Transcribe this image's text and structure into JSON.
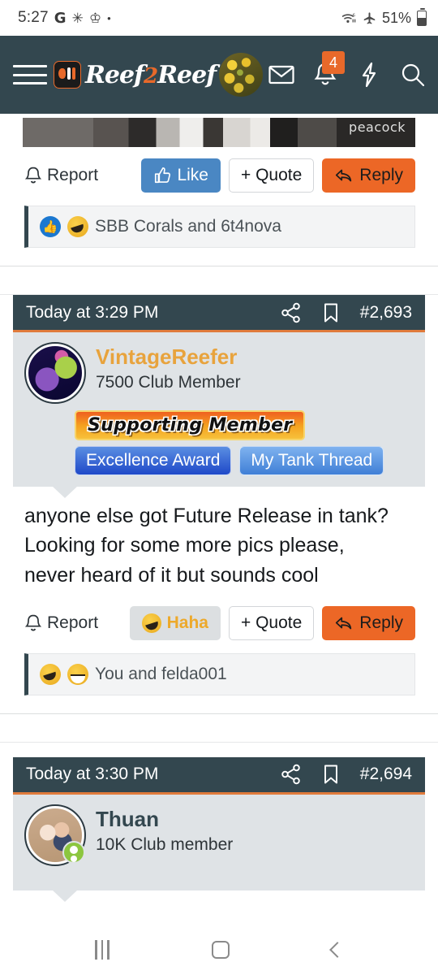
{
  "status_bar": {
    "time": "5:27",
    "google_glyph": "G",
    "asterisk_glyph": "✳",
    "trophy_glyph": "♔",
    "dot_glyph": "•",
    "battery_percent": "51%",
    "wifi_icon": "wifi-6-icon",
    "airplane_icon": "airplane-mode-icon",
    "battery_icon": "battery-icon"
  },
  "header": {
    "menu_icon": "hamburger-menu-icon",
    "logo_mark": "reef2reef-fish-logo",
    "brand_part1": "Reef",
    "brand_two": "2",
    "brand_part2": "Reef",
    "user_avatar": "coral-avatar",
    "inbox_icon": "envelope-icon",
    "alerts_icon": "bell-icon",
    "alerts_count": "4",
    "whats_new_icon": "lightning-bolt-icon",
    "search_icon": "search-icon",
    "bg_color": "#33474f",
    "accent_color": "#e8692a"
  },
  "post_top": {
    "media_watermark": "peacock",
    "report_label": "Report",
    "like_label": "Like",
    "quote_label": "+ Quote",
    "reply_label": "Reply",
    "reactions_text": "SBB Corals and 6t4nova"
  },
  "post_middle": {
    "timestamp": "Today at 3:29 PM",
    "post_number": "#2,693",
    "share_icon": "share-icon",
    "bookmark_icon": "bookmark-icon",
    "username": "VintageReefer",
    "user_title": "7500 Club Member",
    "avatar": "coral-reef-avatar",
    "badge_supporting": "Supporting Member",
    "badge_excellence": "Excellence Award",
    "badge_tank_thread": "My Tank Thread",
    "body_line1": "anyone else got Future Release in tank?",
    "body_line2": "Looking for some more pics please,",
    "body_line3": "never heard of it but sounds cool",
    "report_label": "Report",
    "haha_label": "Haha",
    "quote_label": "+ Quote",
    "reply_label": "Reply",
    "reactions_text": "You and felda001"
  },
  "post_bottom": {
    "timestamp": "Today at 3:30 PM",
    "post_number": "#2,694",
    "share_icon": "share-icon",
    "bookmark_icon": "bookmark-icon",
    "username": "Thuan",
    "user_title": "10K Club member",
    "avatar": "children-photo-avatar",
    "online_status": "online-indicator"
  },
  "nav_bar": {
    "recents_icon": "recents-icon",
    "home_icon": "home-icon",
    "back_icon": "back-icon"
  }
}
